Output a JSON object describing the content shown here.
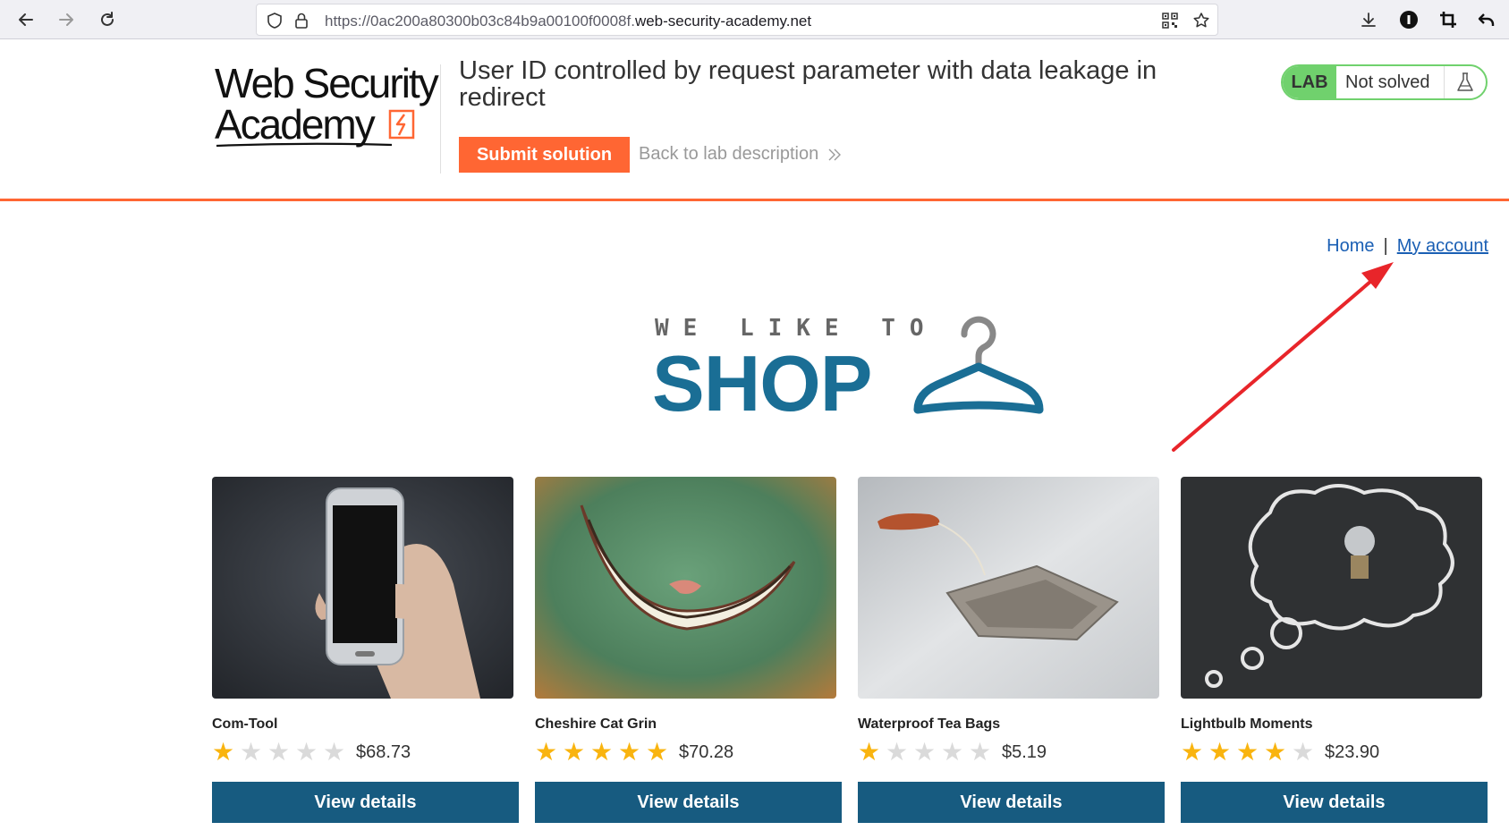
{
  "browser": {
    "url_prefix": "https://0ac200a80300b03c84b9a00100f0008f.",
    "url_host": "web-security-academy.net"
  },
  "header": {
    "logo_line1": "Web Security",
    "logo_line2": "Academy",
    "title": "User ID controlled by request parameter with data leakage in redirect",
    "submit_label": "Submit solution",
    "back_label": "Back to lab description",
    "status_badge": "LAB",
    "status_text": "Not solved"
  },
  "nav": {
    "home": "Home",
    "separator": "|",
    "account": "My account"
  },
  "hero": {
    "tagline": "WE LIKE TO",
    "headline": "SHOP"
  },
  "products": [
    {
      "name": "Com-Tool",
      "rating": 1,
      "price": "$68.73",
      "button": "View details",
      "image": "hand-holding-phone"
    },
    {
      "name": "Cheshire Cat Grin",
      "rating": 5,
      "price": "$70.28",
      "button": "View details",
      "image": "cheshire-grin"
    },
    {
      "name": "Waterproof Tea Bags",
      "rating": 1,
      "price": "$5.19",
      "button": "View details",
      "image": "tea-bag"
    },
    {
      "name": "Lightbulb Moments",
      "rating": 4,
      "price": "$23.90",
      "button": "View details",
      "image": "lightbulb-chalkboard"
    }
  ],
  "colors": {
    "accent": "#ff6633",
    "primary_button": "#175b80",
    "status_green": "#70d16d",
    "star": "#f9b40f",
    "annotation_arrow": "#e8252a"
  },
  "annotation": {
    "type": "arrow",
    "target": "My account"
  }
}
